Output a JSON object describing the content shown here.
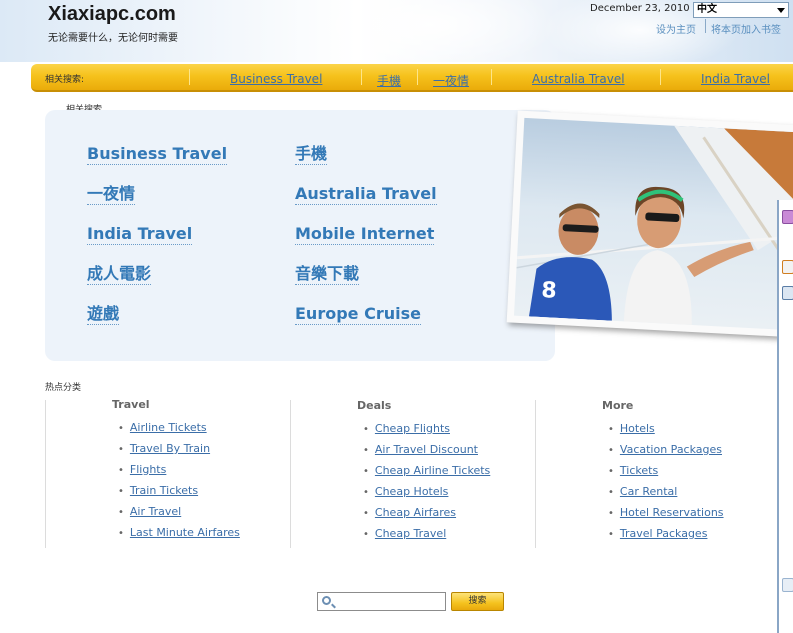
{
  "header": {
    "logo": "Xiaxiapc.com",
    "tagline": "无论需要什么，无论何时需要",
    "date": "December 23, 2010",
    "language": "中文",
    "links": [
      "设为主页",
      "将本页加入书签"
    ]
  },
  "navbar": {
    "label": "相关搜索:",
    "links": [
      "Business Travel",
      "手機",
      "一夜情",
      "Australia Travel",
      "India Travel"
    ]
  },
  "related": {
    "label": "相关搜索",
    "links": [
      "Business Travel",
      "手機",
      "一夜情",
      "Australia Travel",
      "India Travel",
      "Mobile Internet",
      "成人電影",
      "音樂下載",
      "遊戲",
      "Europe Cruise"
    ]
  },
  "categories": {
    "label": "热点分类",
    "columns": [
      {
        "title": "Travel",
        "items": [
          "Airline Tickets",
          "Travel By Train",
          "Flights",
          "Train Tickets",
          "Air Travel",
          "Last Minute Airfares"
        ]
      },
      {
        "title": "Deals",
        "items": [
          "Cheap Flights",
          "Air Travel Discount",
          "Cheap Airline Tickets",
          "Cheap Hotels",
          "Cheap Airfares",
          "Cheap Travel"
        ]
      },
      {
        "title": "More",
        "items": [
          "Hotels",
          "Vacation Packages",
          "Tickets",
          "Car Rental",
          "Hotel Reservations",
          "Travel Packages"
        ]
      }
    ]
  },
  "search": {
    "value": "",
    "button": "搜索"
  },
  "colors": {
    "link": "#3b6ea8",
    "nav_bar": "#f6c21c",
    "panel": "#edf3fa"
  }
}
